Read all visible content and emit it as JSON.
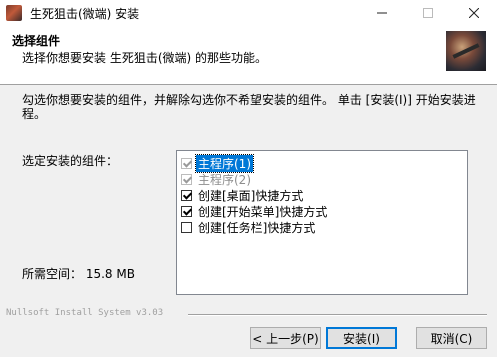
{
  "window": {
    "title": "生死狙击(微端) 安装",
    "min_icon": "minimize-icon",
    "max_icon": "maximize-icon",
    "close_icon": "close-icon"
  },
  "header": {
    "title": "选择组件",
    "subtitle": "选择你想要安装 生死狙击(微端) 的那些功能。"
  },
  "body": {
    "description": "勾选你想要安装的组件，并解除勾选你不希望安装的组件。 单击 [安装(I)] 开始安装进程。",
    "select_label": "选定安装的组件：",
    "space_label": "所需空间： 15.8 MB"
  },
  "components": [
    {
      "label": "主程序(1)",
      "checked": true,
      "disabled": true,
      "selected": true
    },
    {
      "label": "主程序(2)",
      "checked": true,
      "disabled": true,
      "selected": false
    },
    {
      "label": "创建[桌面]快捷方式",
      "checked": true,
      "disabled": false,
      "selected": false
    },
    {
      "label": "创建[开始菜单]快捷方式",
      "checked": true,
      "disabled": false,
      "selected": false
    },
    {
      "label": "创建[任务栏]快捷方式",
      "checked": false,
      "disabled": false,
      "selected": false
    }
  ],
  "footer": {
    "branding": "Nullsoft Install System v3.03",
    "back_label": "< 上一步(P)",
    "install_label": "安装(I)",
    "cancel_label": "取消(C)"
  },
  "colors": {
    "accent": "#0078d7",
    "background": "#f0f0f0"
  }
}
